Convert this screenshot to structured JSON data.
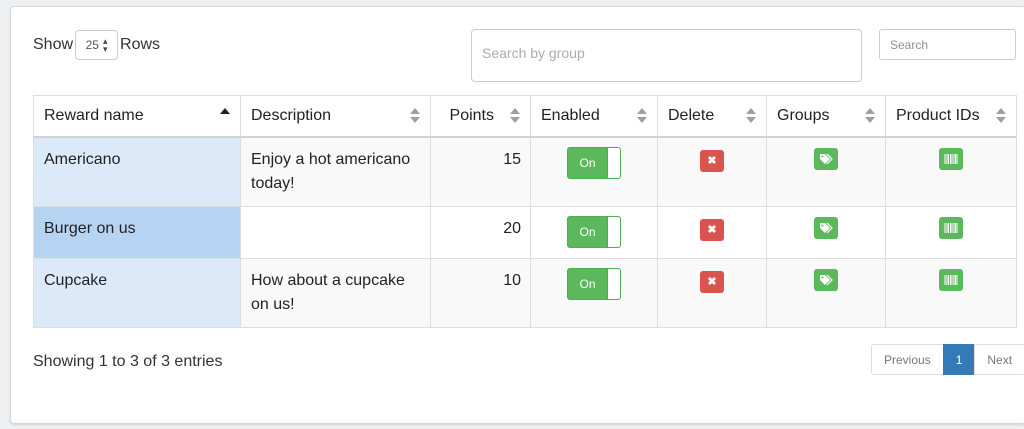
{
  "controls": {
    "show_label": "Show",
    "rows_value": "25",
    "rows_label": "Rows",
    "group_search_placeholder": "Search by group",
    "search_placeholder": "Search"
  },
  "table": {
    "headers": [
      "Reward name",
      "Description",
      "Points",
      "Enabled",
      "Delete",
      "Groups",
      "Product IDs"
    ],
    "sort": {
      "column": "Reward name",
      "direction": "ascending"
    },
    "rows": [
      {
        "name": "Americano",
        "description": "Enjoy a hot americano today!",
        "points": "15",
        "enabled": "On"
      },
      {
        "name": "Burger on us",
        "description": "",
        "points": "20",
        "enabled": "On"
      },
      {
        "name": "Cupcake",
        "description": "How about a cupcake on us!",
        "points": "10",
        "enabled": "On"
      }
    ]
  },
  "footer": {
    "info": "Showing 1 to 3 of 3 entries",
    "pagination": {
      "previous": "Previous",
      "current": "1",
      "next": "Next"
    }
  },
  "icons": {
    "delete": "x-icon",
    "groups": "tags-icon",
    "product_ids": "barcode-icon"
  },
  "colors": {
    "enabled": "#5cb85c",
    "delete": "#d9534f",
    "active_page": "#337ab7",
    "selected_row": "#b7d3f2"
  }
}
